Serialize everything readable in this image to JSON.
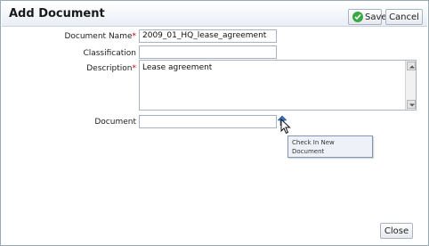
{
  "dialog": {
    "title": "Add Document",
    "save_label": "Save",
    "cancel_label": "Cancel",
    "close_label": "Close"
  },
  "form": {
    "document_name": {
      "label": "Document Name",
      "required_mark": "*",
      "value": "2009_01_HQ_lease_agreement"
    },
    "classification": {
      "label": "Classification",
      "value": ""
    },
    "description": {
      "label": "Description",
      "required_mark": "*",
      "value": "Lease agreement"
    },
    "document": {
      "label": "Document",
      "value": ""
    }
  },
  "tooltip": {
    "line1": "Check In New",
    "line2": "Document"
  },
  "colors": {
    "required": "#cc0000",
    "save_check": "#3aa843",
    "upload_arrow": "#3b6fb6"
  }
}
